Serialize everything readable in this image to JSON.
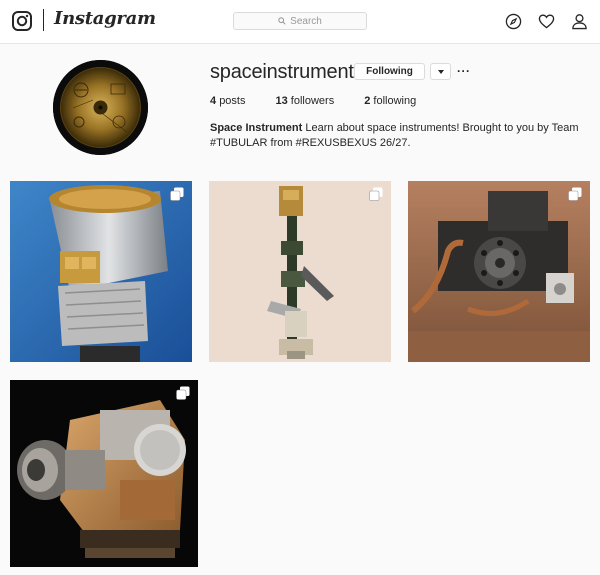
{
  "nav": {
    "wordmark": "Instagram",
    "search_placeholder": "Search",
    "icons": [
      "instagram-glyph-icon",
      "search-icon",
      "compass-icon",
      "heart-icon",
      "profile-icon"
    ]
  },
  "profile": {
    "username": "spaceinstrument",
    "follow_label": "Following",
    "more_label": "···",
    "stats": [
      {
        "count": "4",
        "label": "posts"
      },
      {
        "count": "13",
        "label": "followers"
      },
      {
        "count": "2",
        "label": "following"
      }
    ],
    "bio_name": "Space Instrument",
    "bio_text": "Learn about space instruments! Brought to you by Team #TUBULAR from #REXUSBEXUS 26/27."
  },
  "posts": [
    {
      "accent": "#1f5fae",
      "icon": "multiple-images-icon"
    },
    {
      "accent": "#ecdcd0",
      "icon": "multiple-images-icon"
    },
    {
      "accent": "#9a6a4e",
      "icon": "multiple-images-icon"
    },
    {
      "accent": "#0a0a0a",
      "icon": "multiple-images-icon"
    }
  ]
}
